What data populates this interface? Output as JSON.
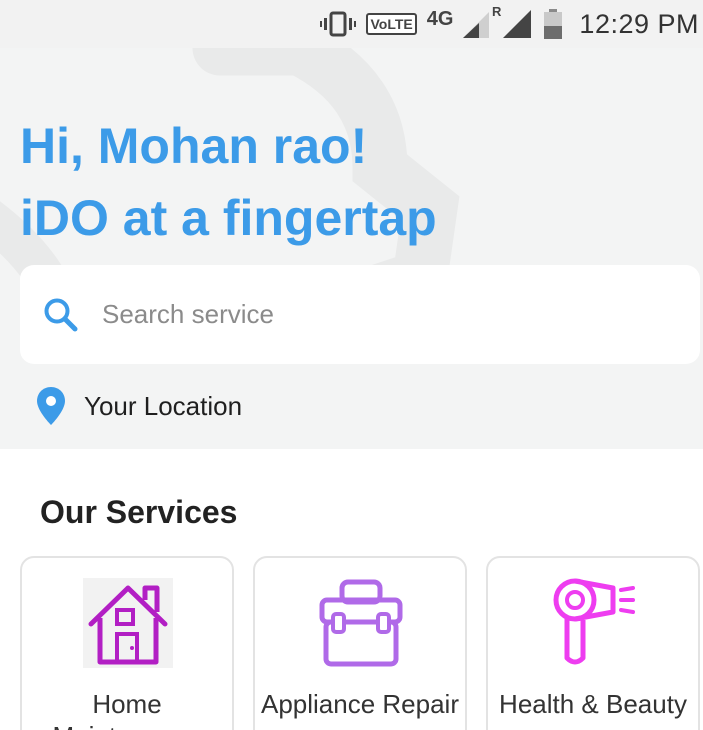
{
  "status_bar": {
    "network_label": "4G",
    "volte_label": "VoLTE",
    "roaming_label": "R",
    "time": "12:29 PM"
  },
  "hero": {
    "greeting_line1": "Hi, Mohan rao!",
    "greeting_line2": "iDO at a fingertap"
  },
  "search": {
    "placeholder": "Search service"
  },
  "location": {
    "label": "Your Location"
  },
  "services": {
    "title": "Our Services",
    "items": [
      {
        "label": "Home Maintenance",
        "icon": "house-icon"
      },
      {
        "label": "Appliance Repair",
        "icon": "toolbox-icon"
      },
      {
        "label": "Health & Beauty",
        "icon": "hair-dryer-icon"
      }
    ]
  },
  "colors": {
    "accent": "#3c9be8",
    "hero_bg": "#f3f4f4",
    "house_icon": "#b21fc4",
    "toolbox_icon": "#b06ae8",
    "dryer_icon": "#ee3df0"
  }
}
